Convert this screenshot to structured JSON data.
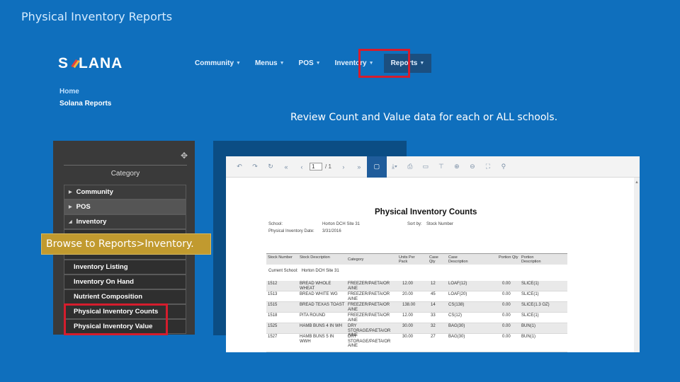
{
  "slide": {
    "title": "Physical Inventory Reports",
    "caption_review": "Review Count and Value data for each or ALL schools.",
    "caption_browse": "Browse to Reports>Inventory."
  },
  "brand": {
    "logo_left": "S",
    "logo_right": "LANA"
  },
  "nav": {
    "items": [
      {
        "label": "Community"
      },
      {
        "label": "Menus"
      },
      {
        "label": "POS"
      },
      {
        "label": "Inventory"
      },
      {
        "label": "Reports"
      }
    ]
  },
  "breadcrumb": {
    "home": "Home",
    "current": "Solana Reports"
  },
  "sidebar": {
    "heading": "Category",
    "items": [
      {
        "label": "Community"
      },
      {
        "label": "POS"
      },
      {
        "label": "Inventory"
      },
      {
        "label": "Inventory Listing"
      },
      {
        "label": "Inventory On Hand"
      },
      {
        "label": "Nutrient Composition"
      },
      {
        "label": "Physical Inventory Counts"
      },
      {
        "label": "Physical Inventory Value"
      }
    ]
  },
  "viewer": {
    "page_value": "1",
    "page_total": "/ 1",
    "report": {
      "title": "Physical Inventory Counts",
      "school_label": "School:",
      "school_value": "Horton DCH Site 31",
      "sort_label": "Sort by:",
      "sort_value": "Stock Number",
      "date_label": "Physical Inventory Date:",
      "date_value": "3/31/2016",
      "columns": [
        "Stock Number",
        "Stock Description",
        "Category",
        "Units Per Pack",
        "Case Qty",
        "Case Description",
        "Portion Qty",
        "Portion Description"
      ],
      "current_school_label": "Current School:",
      "current_school_value": "Horton DCH Site 31",
      "rows": [
        [
          "1512",
          "BREAD WHOLE WHEAT",
          "FREEZER/PAETA/OR AINE",
          "12.00",
          "12",
          "LOAF(12)",
          "0.00",
          "SLICE(1)"
        ],
        [
          "1513",
          "BREAD WHITE WG",
          "FREEZER/PAETA/OR AINE",
          "20.00",
          "45",
          "LOAF(20)",
          "0.00",
          "SLICE(1)"
        ],
        [
          "1515",
          "BREAD TEXAS TOAST",
          "FREEZER/PAETA/OR AINE",
          "138.00",
          "14",
          "CS(138)",
          "0.00",
          "SLICE(1.3 OZ)"
        ],
        [
          "1518",
          "PITA ROUND",
          "FREEZER/PAETA/OR AINE",
          "12.00",
          "33",
          "CS(12)",
          "0.00",
          "SLICE(1)"
        ],
        [
          "1525",
          "HAMB BUNS 4 IN WH",
          "DRY STORAGE/PAETA/OR AINE",
          "30.00",
          "32",
          "BAG(30)",
          "0.00",
          "BUN(1)"
        ],
        [
          "1527",
          "HAMB BUNS 5 IN WWH",
          "DRY STORAGE/PAETA/OR AINE",
          "30.00",
          "27",
          "BAG(30)",
          "0.00",
          "BUN(1)"
        ]
      ]
    }
  },
  "colors": {
    "background": "#0f6fbd",
    "highlight": "#d51d2d",
    "tooltip": "#c19a2f",
    "nav_active": "#1b4f80"
  }
}
